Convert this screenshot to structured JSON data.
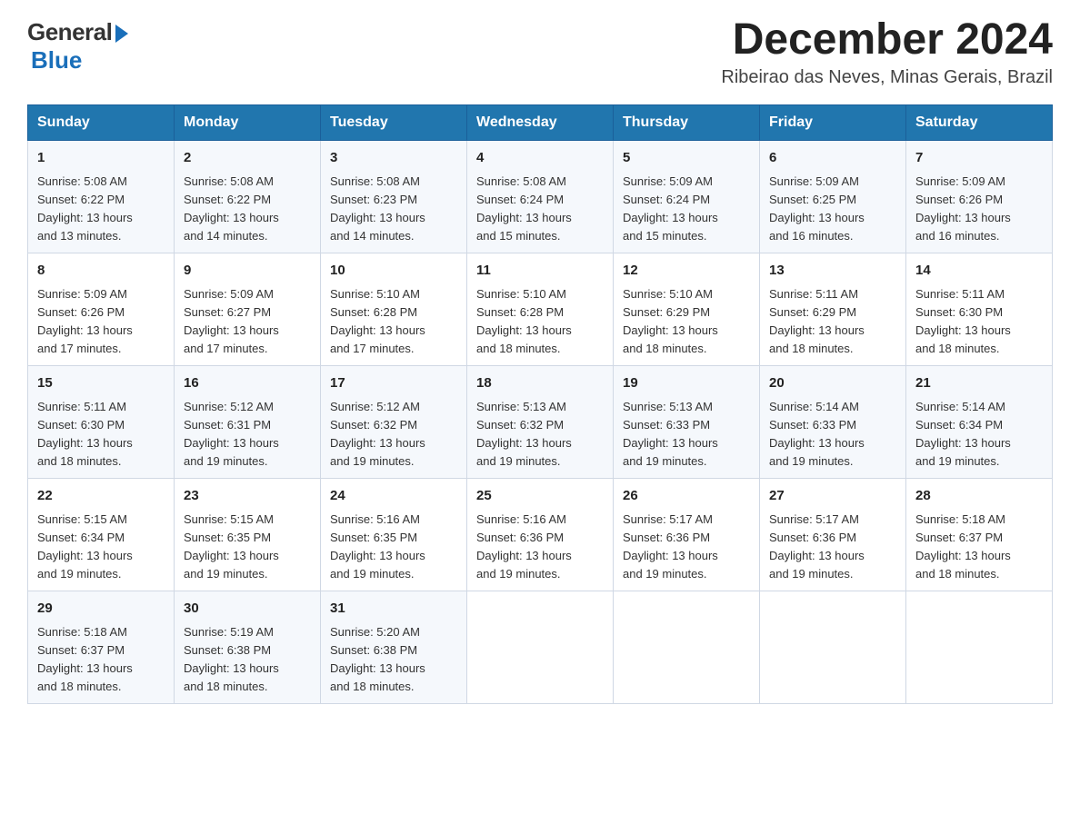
{
  "logo": {
    "general": "General",
    "blue": "Blue",
    "tagline": "Blue"
  },
  "title": {
    "month_year": "December 2024",
    "location": "Ribeirao das Neves, Minas Gerais, Brazil"
  },
  "weekdays": [
    "Sunday",
    "Monday",
    "Tuesday",
    "Wednesday",
    "Thursday",
    "Friday",
    "Saturday"
  ],
  "weeks": [
    [
      {
        "day": "1",
        "sunrise": "5:08 AM",
        "sunset": "6:22 PM",
        "daylight": "13 hours and 13 minutes."
      },
      {
        "day": "2",
        "sunrise": "5:08 AM",
        "sunset": "6:22 PM",
        "daylight": "13 hours and 14 minutes."
      },
      {
        "day": "3",
        "sunrise": "5:08 AM",
        "sunset": "6:23 PM",
        "daylight": "13 hours and 14 minutes."
      },
      {
        "day": "4",
        "sunrise": "5:08 AM",
        "sunset": "6:24 PM",
        "daylight": "13 hours and 15 minutes."
      },
      {
        "day": "5",
        "sunrise": "5:09 AM",
        "sunset": "6:24 PM",
        "daylight": "13 hours and 15 minutes."
      },
      {
        "day": "6",
        "sunrise": "5:09 AM",
        "sunset": "6:25 PM",
        "daylight": "13 hours and 16 minutes."
      },
      {
        "day": "7",
        "sunrise": "5:09 AM",
        "sunset": "6:26 PM",
        "daylight": "13 hours and 16 minutes."
      }
    ],
    [
      {
        "day": "8",
        "sunrise": "5:09 AM",
        "sunset": "6:26 PM",
        "daylight": "13 hours and 17 minutes."
      },
      {
        "day": "9",
        "sunrise": "5:09 AM",
        "sunset": "6:27 PM",
        "daylight": "13 hours and 17 minutes."
      },
      {
        "day": "10",
        "sunrise": "5:10 AM",
        "sunset": "6:28 PM",
        "daylight": "13 hours and 17 minutes."
      },
      {
        "day": "11",
        "sunrise": "5:10 AM",
        "sunset": "6:28 PM",
        "daylight": "13 hours and 18 minutes."
      },
      {
        "day": "12",
        "sunrise": "5:10 AM",
        "sunset": "6:29 PM",
        "daylight": "13 hours and 18 minutes."
      },
      {
        "day": "13",
        "sunrise": "5:11 AM",
        "sunset": "6:29 PM",
        "daylight": "13 hours and 18 minutes."
      },
      {
        "day": "14",
        "sunrise": "5:11 AM",
        "sunset": "6:30 PM",
        "daylight": "13 hours and 18 minutes."
      }
    ],
    [
      {
        "day": "15",
        "sunrise": "5:11 AM",
        "sunset": "6:30 PM",
        "daylight": "13 hours and 18 minutes."
      },
      {
        "day": "16",
        "sunrise": "5:12 AM",
        "sunset": "6:31 PM",
        "daylight": "13 hours and 19 minutes."
      },
      {
        "day": "17",
        "sunrise": "5:12 AM",
        "sunset": "6:32 PM",
        "daylight": "13 hours and 19 minutes."
      },
      {
        "day": "18",
        "sunrise": "5:13 AM",
        "sunset": "6:32 PM",
        "daylight": "13 hours and 19 minutes."
      },
      {
        "day": "19",
        "sunrise": "5:13 AM",
        "sunset": "6:33 PM",
        "daylight": "13 hours and 19 minutes."
      },
      {
        "day": "20",
        "sunrise": "5:14 AM",
        "sunset": "6:33 PM",
        "daylight": "13 hours and 19 minutes."
      },
      {
        "day": "21",
        "sunrise": "5:14 AM",
        "sunset": "6:34 PM",
        "daylight": "13 hours and 19 minutes."
      }
    ],
    [
      {
        "day": "22",
        "sunrise": "5:15 AM",
        "sunset": "6:34 PM",
        "daylight": "13 hours and 19 minutes."
      },
      {
        "day": "23",
        "sunrise": "5:15 AM",
        "sunset": "6:35 PM",
        "daylight": "13 hours and 19 minutes."
      },
      {
        "day": "24",
        "sunrise": "5:16 AM",
        "sunset": "6:35 PM",
        "daylight": "13 hours and 19 minutes."
      },
      {
        "day": "25",
        "sunrise": "5:16 AM",
        "sunset": "6:36 PM",
        "daylight": "13 hours and 19 minutes."
      },
      {
        "day": "26",
        "sunrise": "5:17 AM",
        "sunset": "6:36 PM",
        "daylight": "13 hours and 19 minutes."
      },
      {
        "day": "27",
        "sunrise": "5:17 AM",
        "sunset": "6:36 PM",
        "daylight": "13 hours and 19 minutes."
      },
      {
        "day": "28",
        "sunrise": "5:18 AM",
        "sunset": "6:37 PM",
        "daylight": "13 hours and 18 minutes."
      }
    ],
    [
      {
        "day": "29",
        "sunrise": "5:18 AM",
        "sunset": "6:37 PM",
        "daylight": "13 hours and 18 minutes."
      },
      {
        "day": "30",
        "sunrise": "5:19 AM",
        "sunset": "6:38 PM",
        "daylight": "13 hours and 18 minutes."
      },
      {
        "day": "31",
        "sunrise": "5:20 AM",
        "sunset": "6:38 PM",
        "daylight": "13 hours and 18 minutes."
      },
      null,
      null,
      null,
      null
    ]
  ],
  "labels": {
    "sunrise": "Sunrise:",
    "sunset": "Sunset:",
    "daylight": "Daylight:"
  }
}
